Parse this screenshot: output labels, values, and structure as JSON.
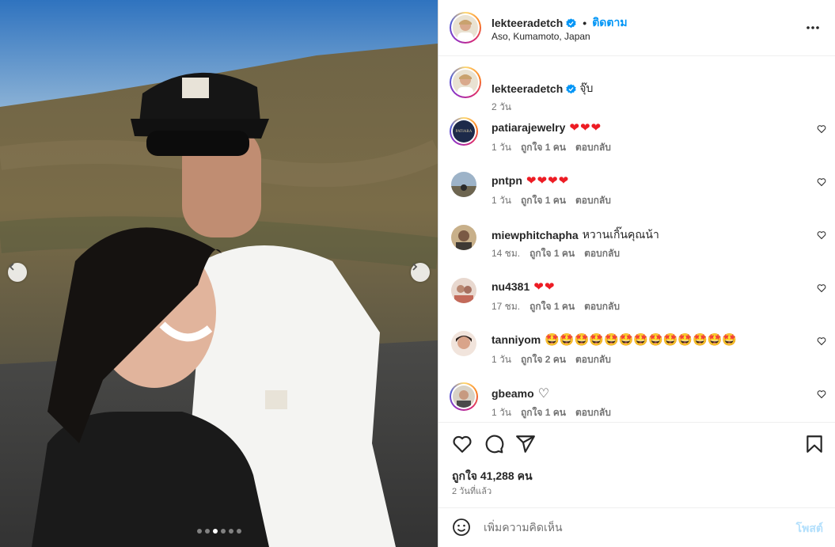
{
  "post": {
    "author": "lekteeradetch",
    "follow_label": "ติดตาม",
    "bullet": "•",
    "location": "Aso, Kumamoto, Japan",
    "caption_text": "จุ๊บ",
    "caption_time": "2 วัน",
    "carousel": {
      "slide_count": 6,
      "active_index": 2
    }
  },
  "comments": [
    {
      "username": "patiarajewelry",
      "text": "❤❤❤",
      "time": "1 วัน",
      "likes": "ถูกใจ 1 คน",
      "reply": "ตอบกลับ",
      "avatar_text": "PATIARA",
      "avatar_ring": true
    },
    {
      "username": "pntpn",
      "text": "❤❤❤❤",
      "time": "1 วัน",
      "likes": "ถูกใจ 1 คน",
      "reply": "ตอบกลับ",
      "avatar_ring": false
    },
    {
      "username": "miewphitchapha",
      "text": "หวานเกิ๊นคุณน้า",
      "time": "14 ชม.",
      "likes": "ถูกใจ 1 คน",
      "reply": "ตอบกลับ",
      "avatar_ring": false
    },
    {
      "username": "nu4381",
      "text": "❤❤",
      "time": "17 ชม.",
      "likes": "ถูกใจ 1 คน",
      "reply": "ตอบกลับ",
      "avatar_ring": false
    },
    {
      "username": "tanniyom",
      "text": "🤩🤩🤩🤩🤩🤩🤩🤩🤩🤩🤩🤩🤩",
      "time": "1 วัน",
      "likes": "ถูกใจ 2 คน",
      "reply": "ตอบกลับ",
      "avatar_ring": false
    },
    {
      "username": "gbeamo",
      "text": "♡",
      "time": "1 วัน",
      "likes": "ถูกใจ 1 คน",
      "reply": "ตอบกลับ",
      "avatar_ring": true
    }
  ],
  "engagement": {
    "likes_label": "ถูกใจ 41,288 คน",
    "posted_ago": "2 วันที่แล้ว"
  },
  "composer": {
    "placeholder": "เพิ่มความคิดเห็น",
    "post_label": "โพสต์"
  },
  "icons": {
    "like": "heart-icon",
    "comment": "comment-icon",
    "share": "send-icon",
    "save": "bookmark-icon",
    "more": "more-options-icon",
    "emoji": "emoji-icon",
    "verified": "verified-badge-icon"
  },
  "colors": {
    "link": "#0095f6",
    "muted": "#737373",
    "post_disabled": "#b2dffc",
    "heart": "#ed1c24"
  }
}
